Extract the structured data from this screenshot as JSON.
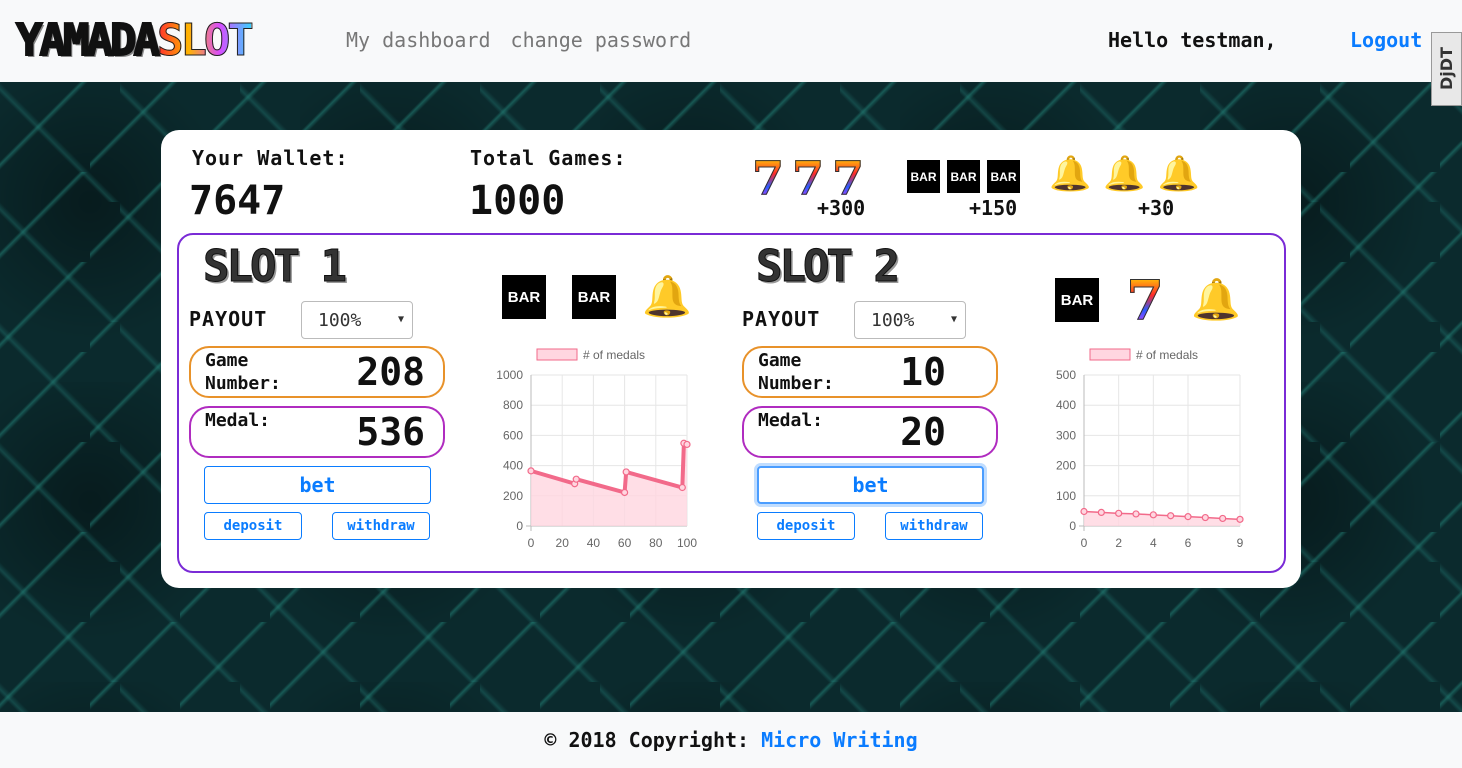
{
  "brand": {
    "part1": "YAMADA",
    "part2": "SLOT"
  },
  "nav": {
    "dashboard": "My dashboard",
    "change_password": "change password"
  },
  "user": {
    "greeting": "Hello testman,",
    "logout": "Logout"
  },
  "debug_toolbar": {
    "label": "DjDT"
  },
  "wallet": {
    "label": "Your Wallet:",
    "value": "7647"
  },
  "games": {
    "label": "Total Games:",
    "value": "1000"
  },
  "paytable": [
    {
      "symbol": "seven",
      "amount": "+300"
    },
    {
      "symbol": "bar",
      "amount": "+150"
    },
    {
      "symbol": "bell",
      "amount": "+30"
    }
  ],
  "symbols": {
    "seven": "7",
    "bar": "BAR",
    "bell": "🔔"
  },
  "slots": [
    {
      "title": "SLOT 1",
      "payout_label": "PAYOUT",
      "payout_value": "100%",
      "game_label_1": "Game",
      "game_label_2": "Number:",
      "game_value": "208",
      "medal_label": "Medal:",
      "medal_value": "536",
      "bet": "bet",
      "deposit": "deposit",
      "withdraw": "withdraw",
      "reels": [
        "bar",
        "bar",
        "bell"
      ],
      "btn_focused": false
    },
    {
      "title": "SLOT 2",
      "payout_label": "PAYOUT",
      "payout_value": "100%",
      "game_label_1": "Game",
      "game_label_2": "Number:",
      "game_value": "10",
      "medal_label": "Medal:",
      "medal_value": "20",
      "bet": "bet",
      "deposit": "deposit",
      "withdraw": "withdraw",
      "reels": [
        "bar",
        "seven",
        "bell"
      ],
      "btn_focused": true
    }
  ],
  "colors": {
    "accent": "#0a7cff",
    "frame": "#7a2bd6",
    "game_pill": "#e8922a",
    "medal_pill": "#b02cc0",
    "series_line": "#f26a8a",
    "series_fill": "#ffd6e0"
  },
  "chart_data": [
    {
      "type": "line",
      "legend": "# of medals",
      "x": [
        0,
        28,
        29,
        60,
        61,
        97,
        98,
        100
      ],
      "y": [
        365,
        280,
        310,
        222,
        358,
        255,
        548,
        540
      ],
      "xlim": [
        0,
        100
      ],
      "ylim": [
        0,
        1000
      ],
      "xticks": [
        0,
        20,
        40,
        60,
        80,
        100
      ],
      "yticks": [
        0,
        200,
        400,
        600,
        800,
        1000
      ],
      "grid": true,
      "legend_position": "top"
    },
    {
      "type": "line",
      "legend": "# of medals",
      "x": [
        0,
        1,
        2,
        3,
        4,
        5,
        6,
        7,
        8,
        9
      ],
      "y": [
        48,
        45,
        42,
        40,
        37,
        34,
        31,
        28,
        25,
        22
      ],
      "xlim": [
        0,
        9
      ],
      "ylim": [
        0,
        500
      ],
      "xticks": [
        0,
        2,
        4,
        6,
        9
      ],
      "yticks": [
        0,
        100,
        200,
        300,
        400,
        500
      ],
      "grid": true,
      "legend_position": "top"
    }
  ]
}
